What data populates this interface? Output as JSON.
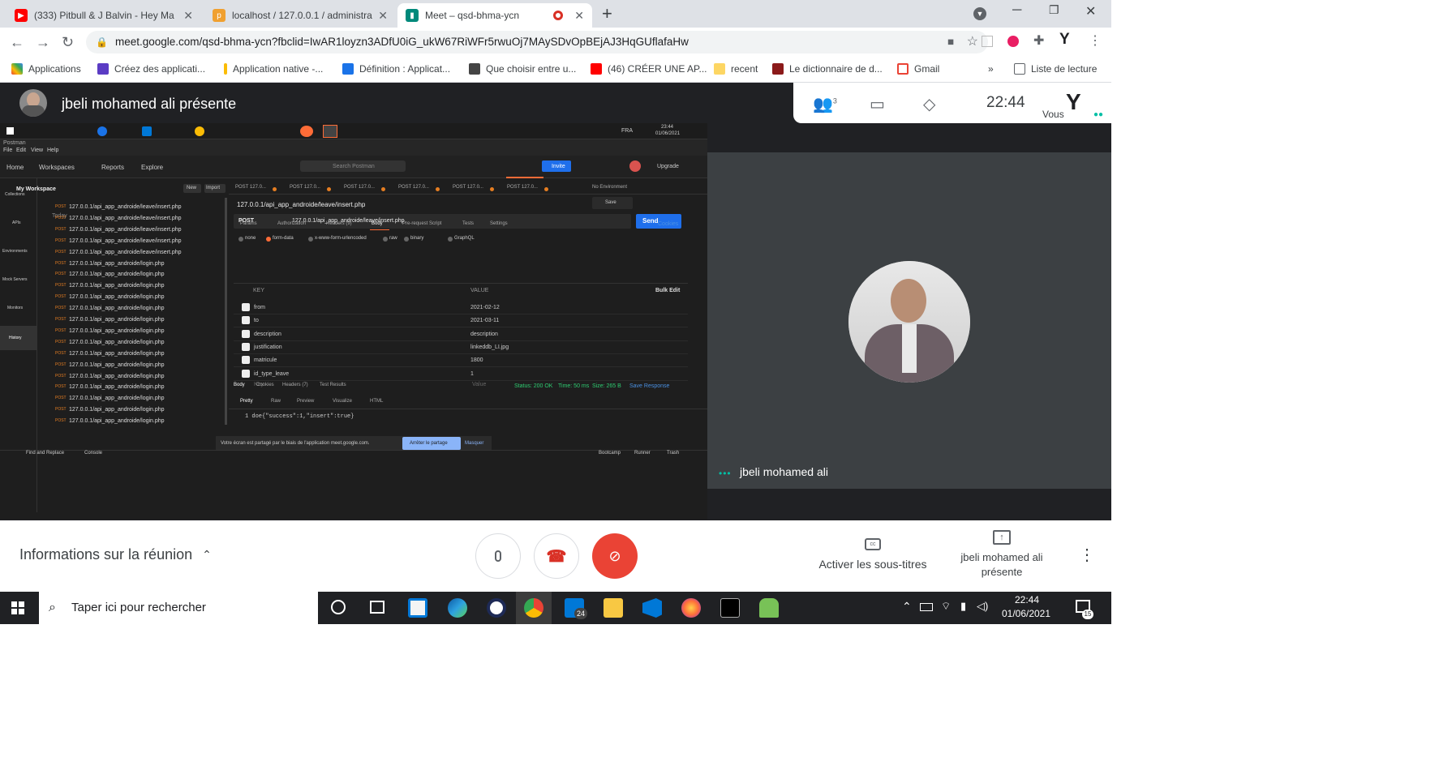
{
  "browser": {
    "tabs": [
      {
        "label": "(333) Pitbull & J Balvin - Hey Ma",
        "favicon": "youtube-icon",
        "color": "#ff0000"
      },
      {
        "label": "localhost / 127.0.0.1 / administra",
        "favicon": "phpmyadmin-icon",
        "color": "#f0a030"
      },
      {
        "label": "Meet – qsd-bhma-ycn",
        "favicon": "google-meet-icon",
        "color": "#00897b"
      }
    ],
    "url": "meet.google.com/qsd-bhma-ycn?fbclid=IwAR1loyzn3ADfU0iG_ukW67RiWFr5rwuOj7MAySDvOpBEjAJ3HqGUflafaHw",
    "bookmarks": [
      {
        "label": "Applications",
        "color": "#ea4335"
      },
      {
        "label": "Créez des applicati...",
        "color": "#5b3cc4"
      },
      {
        "label": "Application native -...",
        "color": "#fbbc05"
      },
      {
        "label": "Définition : Applicat...",
        "color": "#1a73e8"
      },
      {
        "label": "Que choisir entre u...",
        "color": "#444"
      },
      {
        "label": "(46) CRÉER UNE AP...",
        "color": "#ff0000"
      },
      {
        "label": "recent",
        "color": "#fdd663"
      },
      {
        "label": "Le dictionnaire de d...",
        "color": "#8b1a1a"
      },
      {
        "label": "Gmail",
        "color": "#ea4335"
      }
    ],
    "reading_list": "Liste de lecture",
    "more": "»",
    "profile": "Y"
  },
  "meet": {
    "presenter_title": "jbeli mohamed ali présente",
    "participants_count": "3",
    "time": "22:44",
    "self_label": "Vous",
    "self_initial": "Y",
    "tile_name": "jbeli mohamed ali",
    "meeting_info": "Informations sur la réunion",
    "captions_label": "Activer les sous-titres",
    "present_label_1": "jbeli mohamed ali",
    "present_label_2": "présente"
  },
  "shared_screen": {
    "win_time": "23:44",
    "win_date": "01/06/2021",
    "lang": "FRA",
    "menu": [
      "File",
      "Edit",
      "View",
      "Help"
    ],
    "nav": [
      "Home",
      "Workspaces",
      "Reports",
      "Explore"
    ],
    "search": "Search Postman",
    "invite": "Invite",
    "upgrade": "Upgrade",
    "workspace": "My Workspace",
    "new": "New",
    "import": "Import",
    "today": "Today",
    "sidebar_nav": [
      "Collections",
      "APIs",
      "Environments",
      "Mock Servers",
      "Monitors",
      "History"
    ],
    "history": [
      {
        "m": "POST",
        "u": "127.0.0.1/api_app_androide/leave/insert.php"
      },
      {
        "m": "POST",
        "u": "127.0.0.1/api_app_androide/leave/insert.php"
      },
      {
        "m": "POST",
        "u": "127.0.0.1/api_app_androide/leave/insert.php"
      },
      {
        "m": "POST",
        "u": "127.0.0.1/api_app_androide/leave/insert.php"
      },
      {
        "m": "POST",
        "u": "127.0.0.1/api_app_androide/leave/insert.php"
      },
      {
        "m": "POST",
        "u": "127.0.0.1/api_app_androide/login.php"
      },
      {
        "m": "POST",
        "u": "127.0.0.1/api_app_androide/login.php"
      },
      {
        "m": "POST",
        "u": "127.0.0.1/api_app_androide/login.php"
      },
      {
        "m": "POST",
        "u": "127.0.0.1/api_app_androide/login.php"
      },
      {
        "m": "POST",
        "u": "127.0.0.1/api_app_androide/login.php"
      },
      {
        "m": "POST",
        "u": "127.0.0.1/api_app_androide/login.php"
      },
      {
        "m": "POST",
        "u": "127.0.0.1/api_app_androide/login.php"
      },
      {
        "m": "POST",
        "u": "127.0.0.1/api_app_androide/login.php"
      },
      {
        "m": "POST",
        "u": "127.0.0.1/api_app_androide/login.php"
      },
      {
        "m": "POST",
        "u": "127.0.0.1/api_app_androide/login.php"
      },
      {
        "m": "POST",
        "u": "127.0.0.1/api_app_androide/login.php"
      },
      {
        "m": "POST",
        "u": "127.0.0.1/api_app_androide/login.php"
      },
      {
        "m": "POST",
        "u": "127.0.0.1/api_app_androide/login.php"
      },
      {
        "m": "POST",
        "u": "127.0.0.1/api_app_androide/login.php"
      },
      {
        "m": "POST",
        "u": "127.0.0.1/api_app_androide/login.php"
      }
    ],
    "req_tab": "POST 127.0...",
    "no_env": "No Environment",
    "request_title": "127.0.0.1/api_app_androide/leave/insert.php",
    "save": "Save",
    "method": "POST",
    "url": "127.0.0.1/api_app_androide/leave/insert.php",
    "send": "Send",
    "req_tabs": [
      "Params",
      "Authorization",
      "Headers (9)",
      "Body",
      "Pre-request Script",
      "Tests",
      "Settings"
    ],
    "cookies": "Cookies",
    "body_types": [
      "none",
      "form-data",
      "x-www-form-urlencoded",
      "raw",
      "binary",
      "GraphQL"
    ],
    "col_key": "KEY",
    "col_value": "VALUE",
    "bulk_edit": "Bulk Edit",
    "params": [
      {
        "k": "from",
        "v": "2021-02-12"
      },
      {
        "k": "to",
        "v": "2021-03-11"
      },
      {
        "k": "description",
        "v": "description"
      },
      {
        "k": "justification",
        "v": "linkeddb_LI.jpg"
      },
      {
        "k": "matricule",
        "v": "1800"
      },
      {
        "k": "id_type_leave",
        "v": "1"
      }
    ],
    "key_ph": "Key",
    "value_ph": "Value",
    "resp_tabs": [
      "Body",
      "Cookies",
      "Headers (7)",
      "Test Results"
    ],
    "status": "Status: 200 OK",
    "time": "Time: 50 ms",
    "size": "Size: 265 B",
    "save_resp": "Save Response",
    "view_modes": [
      "Pretty",
      "Raw",
      "Preview",
      "Visualize",
      "HTML"
    ],
    "response_line": "1   doe{\"success\":1,\"insert\":true}",
    "share_msg": "Votre écran est partagé par le biais de l'application meet.google.com.",
    "stop_share": "Arrêter le partage",
    "hide": "Masquer",
    "footer": [
      "Find and Replace",
      "Console",
      "Bootcamp",
      "Runner",
      "Trash"
    ]
  },
  "taskbar": {
    "search_placeholder": "Taper ici pour rechercher",
    "time": "22:44",
    "date": "01/06/2021",
    "mail_badge": "24",
    "notif_badge": "15"
  }
}
